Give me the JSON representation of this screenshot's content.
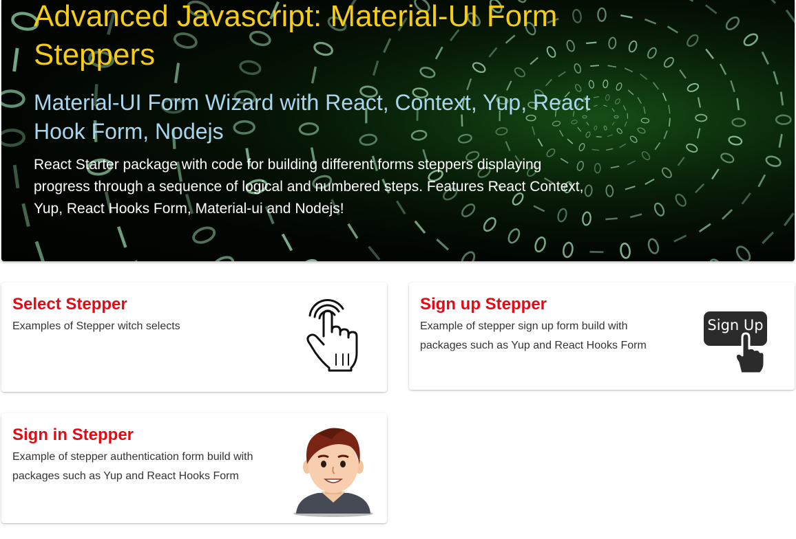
{
  "hero": {
    "title": "Advanced Javascript: Material-UI Form Steppers",
    "subtitle": "Material-UI Form Wizard with React, Context, Yup, React Hook Form, Nodejs",
    "description": "React Starter package with code for building different forms steppers displaying progress through a sequence of logical and numbered steps. Features React Context, Yup, React Hooks Form, Material-ui and Nodejs!",
    "background_icon": "binary-code-tunnel-image"
  },
  "cards": [
    {
      "title": "Select Stepper",
      "text": "Examples of Stepper witch selects",
      "icon": "pointing-hand-icon"
    },
    {
      "title": "Sign up Stepper",
      "text": "Example of stepper sign up form build with packages such as Yup and React Hooks Form",
      "icon": "sign-up-button-icon",
      "icon_label": "Sign Up"
    },
    {
      "title": "Sign in Stepper",
      "text": "Example of stepper authentication form build with packages such as Yup and React Hooks Form",
      "icon": "user-avatar-icon"
    }
  ],
  "colors": {
    "hero_title": "#f5cc16",
    "hero_subtitle": "#a9d6ee",
    "card_title": "#e50914"
  }
}
